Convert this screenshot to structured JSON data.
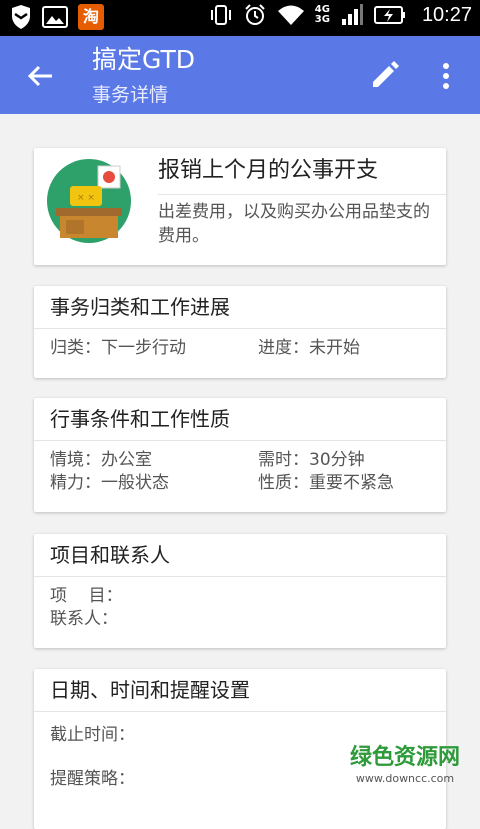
{
  "status_bar": {
    "network_label_top": "4G",
    "network_label_bottom": "3G",
    "time": "10:27",
    "taobao_glyph": "淘"
  },
  "app_bar": {
    "title": "搞定GTD",
    "subtitle": "事务详情",
    "background_color": "#5b79e6"
  },
  "summary": {
    "title": "报销上个月的公事开支",
    "description": "出差费用，以及购买办公用品垫支的费用。"
  },
  "classification": {
    "header": "事务归类和工作进展",
    "category": "归类：下一步行动",
    "progress": "进度：未开始"
  },
  "conditions": {
    "header": "行事条件和工作性质",
    "context": "情境：办公室",
    "time_needed": "需时：30分钟",
    "energy": "精力：一般状态",
    "nature": "性质：重要不紧急"
  },
  "project": {
    "header": "项目和联系人",
    "project_label": "项    目：",
    "contact_label": "联系人："
  },
  "dates": {
    "header": "日期、时间和提醒设置",
    "deadline_label": "截止时间：",
    "reminder_label": "提醒策略："
  },
  "watermark": {
    "name": "绿色资源网",
    "url": "www.downcc.com"
  },
  "icons": [
    "shield-icon",
    "image-icon",
    "taobao-icon",
    "vibrate-icon",
    "alarm-icon",
    "wifi-icon",
    "signal-icon",
    "battery-icon",
    "back-arrow-icon",
    "edit-icon",
    "more-vert-icon"
  ]
}
